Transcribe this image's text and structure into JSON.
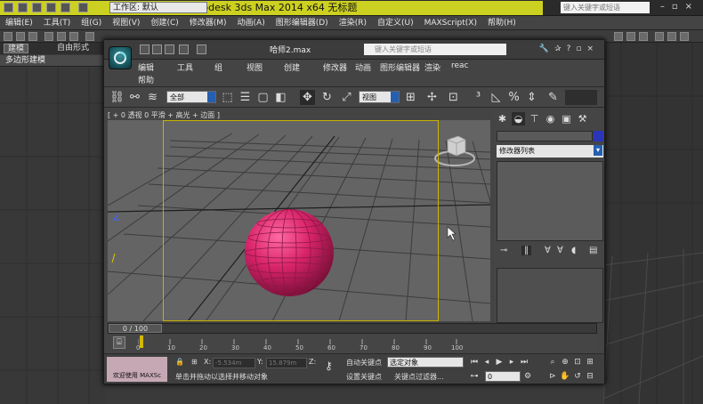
{
  "outer": {
    "app_title": "Autodesk 3ds Max  2014 x64    无标题",
    "workspace": "工作区: 默认",
    "search_placeholder": "键入关键字或短语",
    "menu": [
      "编辑(E)",
      "工具(T)",
      "组(G)",
      "视图(V)",
      "创建(C)",
      "修改器(M)",
      "动画(A)",
      "图形编辑器(D)",
      "渲染(R)",
      "自定义(U)",
      "MAXScript(X)",
      "帮助(H)"
    ],
    "ribbon_tabs": [
      "建模",
      "自由形式"
    ],
    "subtab": "多边形建模"
  },
  "window": {
    "file_name": "哈师2.max",
    "search_placeholder": "键入关键字或短语",
    "menu_row1": [
      "编辑",
      "工具",
      "组",
      "视图",
      "创建",
      "修改器",
      "动画",
      "图形编辑器",
      "渲染",
      "reac"
    ],
    "menu_row2": [
      "帮助"
    ],
    "selection_filter": "全部",
    "ref_coord": "视图",
    "viewport_label": "[ + 0 透视 0 平滑 + 高光 + 边面 ]"
  },
  "command_panel": {
    "modifier_list": "修改器列表"
  },
  "timeline": {
    "slider_label": "0 / 100",
    "ticks": [
      "0",
      "10",
      "20",
      "30",
      "40",
      "50",
      "60",
      "70",
      "80",
      "90",
      "100"
    ]
  },
  "status": {
    "welcome": "欢迎使用 MAXSc",
    "x_label": "X:",
    "x_value": "-5.534m",
    "y_label": "Y:",
    "y_value": "15.879m",
    "z_label": "Z:",
    "hint": "单击并拖动以选择并移动对象",
    "auto_key": "自动关键点",
    "set_key": "设置关键点",
    "selected_dropdown": "选定对象",
    "key_filters": "关键点过滤器...",
    "frame_value": "0"
  },
  "colors": {
    "sphere": "#d9246a",
    "safe_frame": "#c8b400",
    "title_bar": "#ccd020"
  }
}
